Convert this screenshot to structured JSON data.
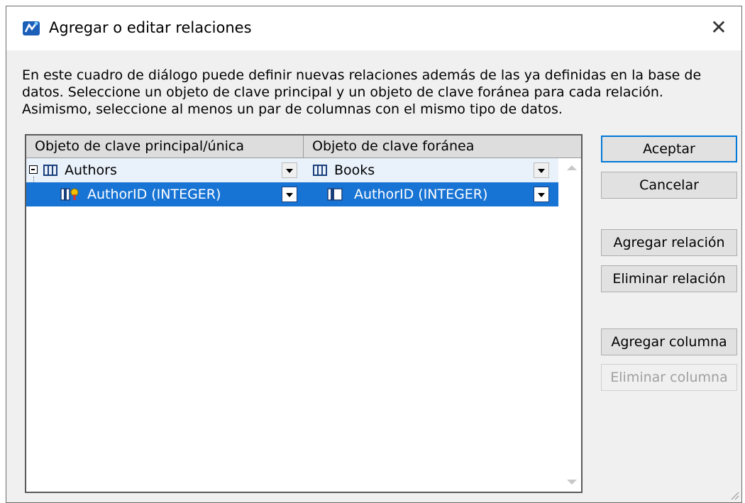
{
  "window": {
    "title": "Agregar o editar relaciones",
    "close_glyph": "✕"
  },
  "description": {
    "lines": [
      "En este cuadro de diálogo puede definir nuevas relaciones además de las ya definidas en la base de",
      "datos. Seleccione un objeto de clave principal y un objeto de clave foránea para cada relación.",
      "Asimismo, seleccione al menos un par de columnas con el mismo tipo de datos."
    ]
  },
  "grid": {
    "columns": [
      "Objeto de clave principal/única",
      "Objeto de clave foránea"
    ],
    "rows": [
      {
        "primary": "Authors",
        "foreign": "Books",
        "primary_icon": "table-icon",
        "foreign_icon": "table-icon",
        "expanded": true
      },
      {
        "primary": "AuthorID (INTEGER)",
        "foreign": "AuthorID (INTEGER)",
        "primary_icon": "primary-key-column-icon",
        "foreign_icon": "column-icon",
        "selected": true
      }
    ]
  },
  "buttons": {
    "ok": "Aceptar",
    "cancel": "Cancelar",
    "add_relation": "Agregar relación",
    "delete_relation": "Eliminar relación",
    "add_column": "Agregar columna",
    "delete_column": "Eliminar columna"
  },
  "colors": {
    "selection": "#1874d4",
    "accent_border": "#0078d7"
  }
}
